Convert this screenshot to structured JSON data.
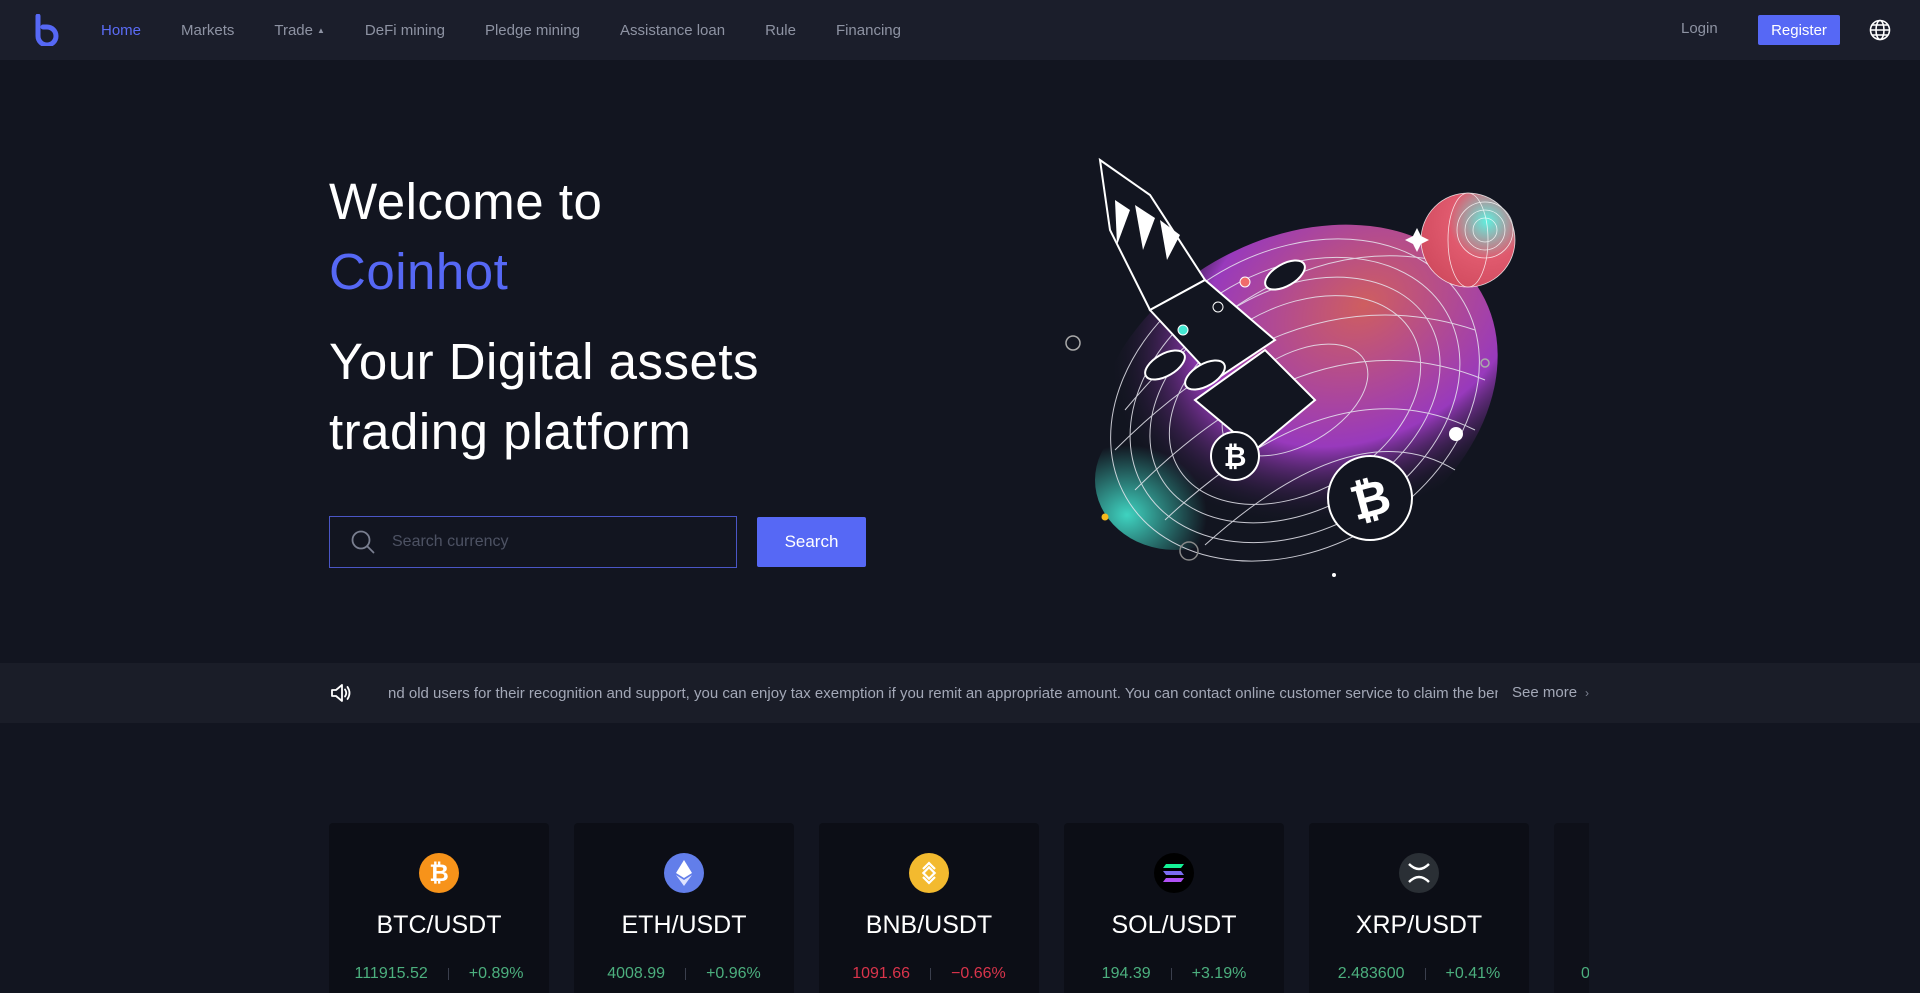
{
  "nav": {
    "items": [
      {
        "label": "Home"
      },
      {
        "label": "Markets"
      },
      {
        "label": "Trade"
      },
      {
        "label": "DeFi mining"
      },
      {
        "label": "Pledge mining"
      },
      {
        "label": "Assistance loan"
      },
      {
        "label": "Rule"
      },
      {
        "label": "Financing"
      }
    ],
    "login": "Login",
    "register": "Register",
    "accent": "#5668f5",
    "icons": [
      "logo-icon",
      "caret-up-icon",
      "globe-icon"
    ]
  },
  "hero": {
    "line1": "Welcome to",
    "line2": "Coinhot",
    "sub1": "Your Digital assets",
    "sub2": "trading platform",
    "search_placeholder": "Search currency",
    "search_button": "Search"
  },
  "notice": {
    "text": "nd old users for their recognition and support, you can enjoy tax exemption if you remit an appropriate amount. You can contact online customer service to claim the benefits",
    "see_more": "See more",
    "icon": "speaker-icon"
  },
  "coins": [
    {
      "pair": "BTC/USDT",
      "price": "111915.52",
      "change": "+0.89%",
      "direction": "up",
      "icon": "btc-icon",
      "color": "#f7931a"
    },
    {
      "pair": "ETH/USDT",
      "price": "4008.99",
      "change": "+0.96%",
      "direction": "up",
      "icon": "eth-icon",
      "color": "#627eea"
    },
    {
      "pair": "BNB/USDT",
      "price": "1091.66",
      "change": "−0.66%",
      "direction": "down",
      "icon": "bnb-icon",
      "color": "#f3ba2f"
    },
    {
      "pair": "SOL/USDT",
      "price": "194.39",
      "change": "+3.19%",
      "direction": "up",
      "icon": "sol-icon",
      "color": "#000000"
    },
    {
      "pair": "XRP/USDT",
      "price": "2.483600",
      "change": "+0.41%",
      "direction": "up",
      "icon": "xrp-icon",
      "color": "#23292f"
    },
    {
      "pair": "",
      "price": "0",
      "change": "",
      "direction": "up",
      "icon": "",
      "color": "#0c0e16"
    }
  ],
  "colors": {
    "up": "#4caf7e",
    "down": "#d9344b",
    "background": "#121520"
  }
}
